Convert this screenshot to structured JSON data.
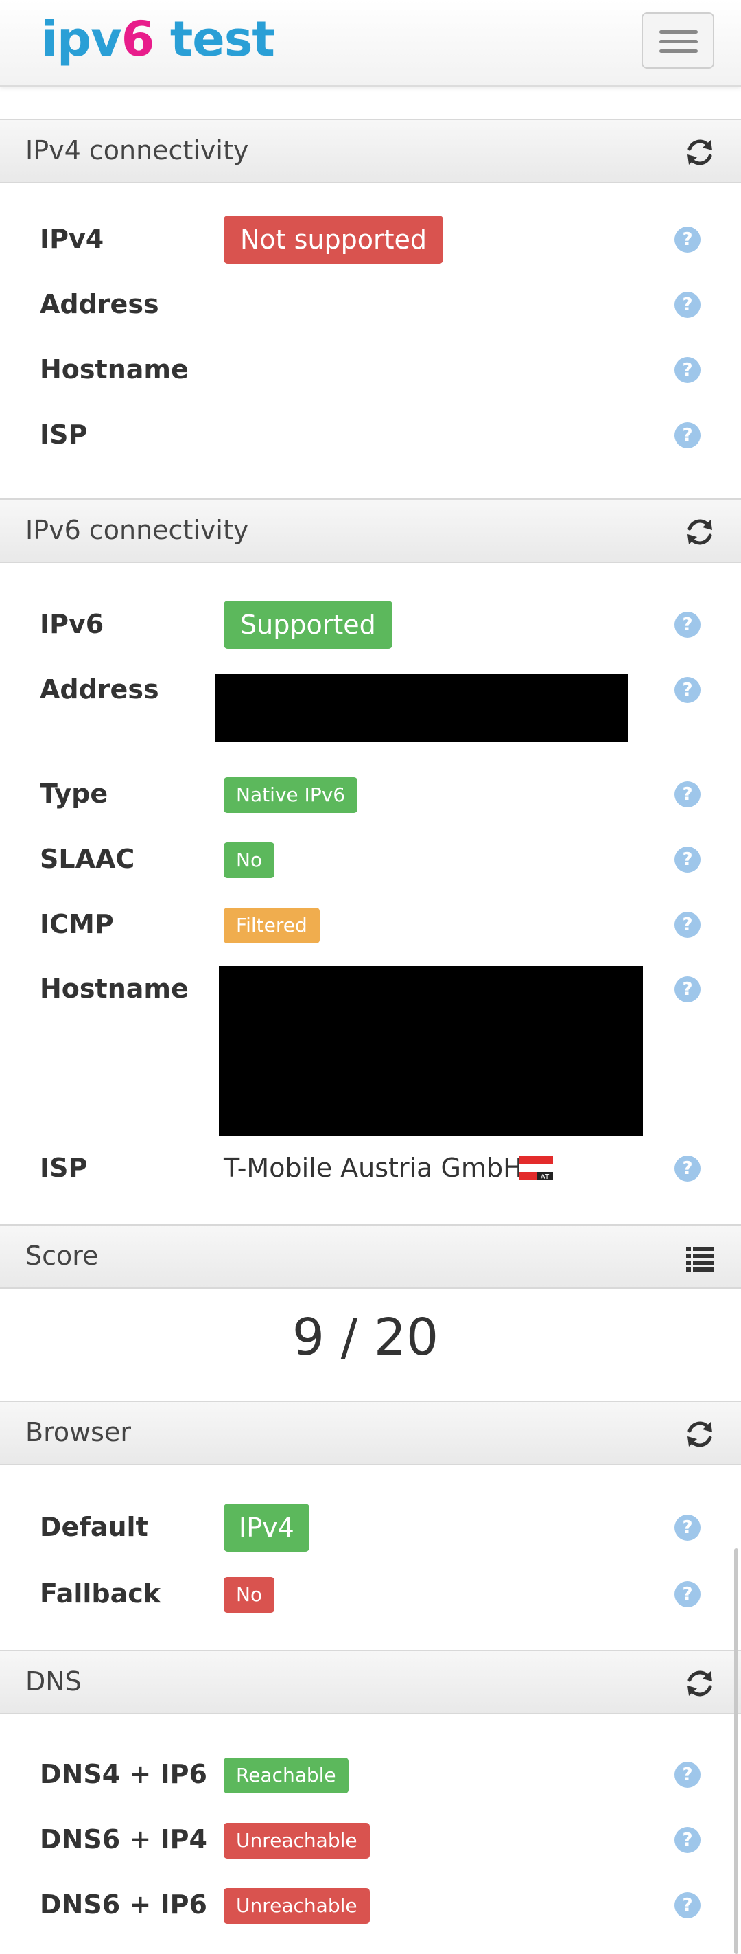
{
  "brand": {
    "ipv": "ipv",
    "six": "6",
    "test": " test"
  },
  "ipv4": {
    "title": "IPv4 connectivity",
    "rows": [
      {
        "label": "IPv4",
        "value": "Not supported"
      },
      {
        "label": "Address"
      },
      {
        "label": "Hostname"
      },
      {
        "label": "ISP"
      }
    ]
  },
  "ipv6": {
    "title": "IPv6 connectivity",
    "ipv6": {
      "label": "IPv6",
      "value": "Supported"
    },
    "address": {
      "label": "Address"
    },
    "type": {
      "label": "Type",
      "value": "Native IPv6"
    },
    "slaac": {
      "label": "SLAAC",
      "value": "No"
    },
    "icmp": {
      "label": "ICMP",
      "value": "Filtered"
    },
    "hostname": {
      "label": "Hostname"
    },
    "isp": {
      "label": "ISP",
      "value": "T-Mobile Austria GmbH",
      "flag_code": "AT"
    }
  },
  "score": {
    "title": "Score",
    "value": "9 / 20"
  },
  "browser": {
    "title": "Browser",
    "default": {
      "label": "Default",
      "value": "IPv4"
    },
    "fallback": {
      "label": "Fallback",
      "value": "No"
    }
  },
  "dns": {
    "title": "DNS",
    "rows": [
      {
        "label": "DNS4 + IP6",
        "value": "Reachable"
      },
      {
        "label": "DNS6 + IP4",
        "value": "Unreachable"
      },
      {
        "label": "DNS6 + IP6",
        "value": "Unreachable"
      }
    ]
  },
  "help_glyph": "?",
  "colors": {
    "red": "#d9534f",
    "green": "#5cb85c",
    "orange": "#f0ad4e",
    "brand_blue": "#2a9fd6",
    "brand_pink": "#e81d8b",
    "help": "#9ec6ea"
  }
}
